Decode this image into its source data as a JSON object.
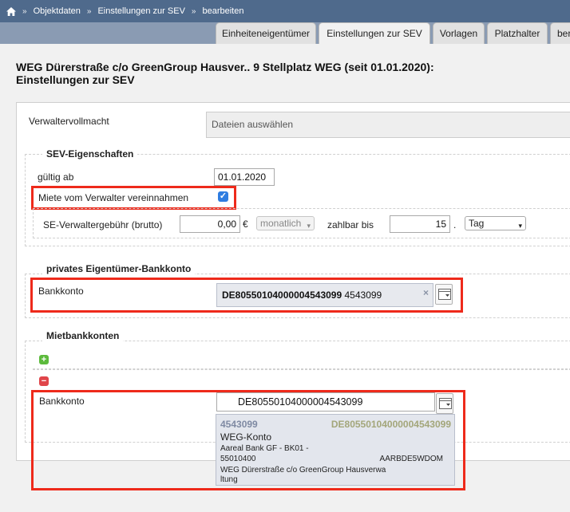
{
  "breadcrumb": {
    "items": [
      "Objektdaten",
      "Einstellungen zur SEV",
      "bearbeiten"
    ]
  },
  "tabs": [
    {
      "label": "Einheiteneigentümer",
      "active": false
    },
    {
      "label": "Einstellungen zur SEV",
      "active": true
    },
    {
      "label": "Vorlagen",
      "active": false
    },
    {
      "label": "Platzhalter",
      "active": false
    },
    {
      "label": "ber",
      "active": false
    }
  ],
  "title": {
    "line1": "WEG Dürerstraße c/o GreenGroup Hausver.. 9 Stellplatz WEG (seit 01.01.2020):",
    "line2": "Einstellungen zur SEV"
  },
  "verwaltervollmacht": {
    "label": "Verwaltervollmacht",
    "placeholder": "Dateien auswählen"
  },
  "sev": {
    "legend": "SEV-Eigenschaften",
    "gueltig_label": "gültig ab",
    "gueltig_value": "01.01.2020",
    "miete_label": "Miete vom Verwalter vereinnahmen",
    "miete_checked": true,
    "gebuehr_label": "SE-Verwaltergebühr (brutto)",
    "gebuehr_value": "0,00",
    "currency": "€",
    "interval": "monatlich",
    "zahlbar_label": "zahlbar bis",
    "zahlbar_value": "15",
    "dot": ".",
    "unit": "Tag"
  },
  "privat": {
    "legend": "privates Eigentümer-Bankkonto",
    "label": "Bankkonto",
    "iban": "DE80550104000004543099",
    "account": "4543099",
    "clear": "×"
  },
  "miet": {
    "legend": "Mietbankkonten",
    "plus": "+",
    "minus": "−",
    "label": "Bankkonto",
    "input_value": "DE80550104000004543099",
    "suggestion": {
      "account": "4543099",
      "iban": "DE80550104000004543099",
      "name": "WEG-Konto",
      "bank_line1": "Aareal Bank GF - BK01 -",
      "bank_line2": "55010400",
      "bic": "AARBDE5WDOM",
      "holder_line1": "WEG Dürerstraße c/o GreenGroup Hausverwa",
      "holder_line2": "ltung"
    }
  },
  "colors": {
    "highlight": "#ee2a1b",
    "header": "#4f6a8c",
    "checkbox": "#2f7de1"
  }
}
